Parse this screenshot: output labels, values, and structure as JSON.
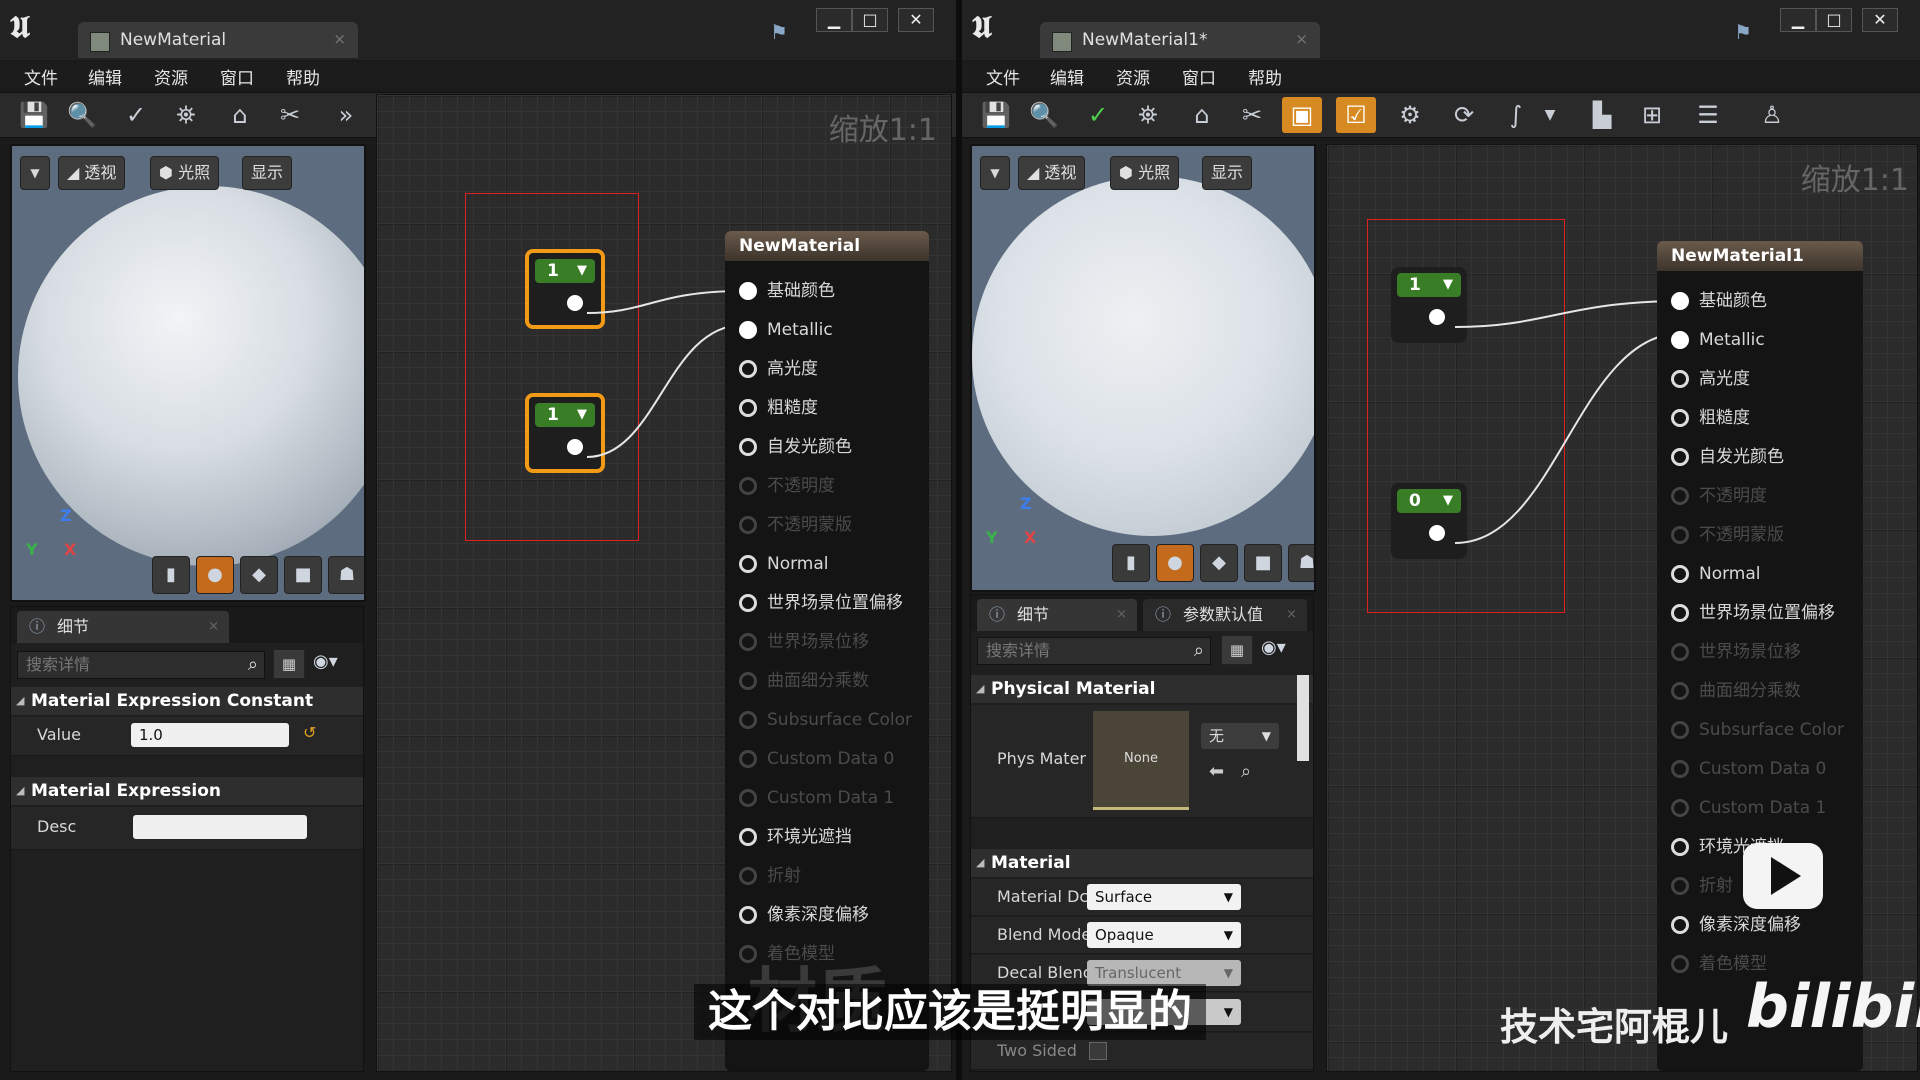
{
  "left": {
    "tab_title": "NewMaterial",
    "tab_close": "×",
    "window_buttons": [
      "▁",
      "□",
      "✕"
    ],
    "menu": [
      "文件",
      "编辑",
      "资源",
      "窗口",
      "帮助"
    ],
    "viewport": {
      "perspective": "透视",
      "lit": "光照",
      "show": "显示",
      "axis_z": "Z",
      "axis_x": "X",
      "axis_y": "Y"
    },
    "zoom_label": "缩放1:1",
    "constants": [
      {
        "value": "1"
      },
      {
        "value": "1"
      }
    ],
    "material_node": {
      "title": "NewMaterial",
      "pins": [
        {
          "label": "基础颜色",
          "state": "connected"
        },
        {
          "label": "Metallic",
          "state": "connected"
        },
        {
          "label": "高光度",
          "state": "active"
        },
        {
          "label": "粗糙度",
          "state": "active"
        },
        {
          "label": "自发光颜色",
          "state": "active"
        },
        {
          "label": "不透明度",
          "state": "disabled"
        },
        {
          "label": "不透明蒙版",
          "state": "disabled"
        },
        {
          "label": "Normal",
          "state": "active"
        },
        {
          "label": "世界场景位置偏移",
          "state": "active"
        },
        {
          "label": "世界场景位移",
          "state": "disabled"
        },
        {
          "label": "曲面细分乘数",
          "state": "disabled"
        },
        {
          "label": "Subsurface Color",
          "state": "disabled"
        },
        {
          "label": "Custom Data 0",
          "state": "disabled"
        },
        {
          "label": "Custom Data 1",
          "state": "disabled"
        },
        {
          "label": "环境光遮挡",
          "state": "active"
        },
        {
          "label": "折射",
          "state": "disabled"
        },
        {
          "label": "像素深度偏移",
          "state": "active"
        },
        {
          "label": "着色模型",
          "state": "disabled"
        }
      ]
    },
    "details": {
      "tab": "细节",
      "tab_close": "×",
      "search_placeholder": "搜索详情",
      "category1": "Material Expression Constant",
      "value_label": "Value",
      "value": "1.0",
      "category2": "Material Expression",
      "desc_label": "Desc",
      "desc_value": ""
    }
  },
  "right": {
    "tab_title": "NewMaterial1*",
    "tab_close": "×",
    "window_buttons": [
      "▁",
      "□",
      "✕"
    ],
    "menu": [
      "文件",
      "编辑",
      "资源",
      "窗口",
      "帮助"
    ],
    "viewport": {
      "perspective": "透视",
      "lit": "光照",
      "show": "显示",
      "axis_z": "Z",
      "axis_x": "X",
      "axis_y": "Y"
    },
    "zoom_label": "缩放1:1",
    "constants": [
      {
        "value": "1"
      },
      {
        "value": "0"
      }
    ],
    "material_node": {
      "title": "NewMaterial1",
      "pins": [
        {
          "label": "基础颜色",
          "state": "connected"
        },
        {
          "label": "Metallic",
          "state": "connected"
        },
        {
          "label": "高光度",
          "state": "active"
        },
        {
          "label": "粗糙度",
          "state": "active"
        },
        {
          "label": "自发光颜色",
          "state": "active"
        },
        {
          "label": "不透明度",
          "state": "disabled"
        },
        {
          "label": "不透明蒙版",
          "state": "disabled"
        },
        {
          "label": "Normal",
          "state": "active"
        },
        {
          "label": "世界场景位置偏移",
          "state": "active"
        },
        {
          "label": "世界场景位移",
          "state": "disabled"
        },
        {
          "label": "曲面细分乘数",
          "state": "disabled"
        },
        {
          "label": "Subsurface Color",
          "state": "disabled"
        },
        {
          "label": "Custom Data 0",
          "state": "disabled"
        },
        {
          "label": "Custom Data 1",
          "state": "disabled"
        },
        {
          "label": "环境光遮挡",
          "state": "active"
        },
        {
          "label": "折射",
          "state": "disabled"
        },
        {
          "label": "像素深度偏移",
          "state": "active"
        },
        {
          "label": "着色模型",
          "state": "disabled"
        }
      ]
    },
    "details": {
      "tab1": "细节",
      "tab2": "参数默认值",
      "tab_close": "×",
      "search_placeholder": "搜索详情",
      "cat_physical": "Physical Material",
      "phys_label": "Phys Mater",
      "phys_thumb": "None",
      "phys_dropdown": "无",
      "cat_material": "Material",
      "domain_label": "Material Dc",
      "domain_value": "Surface",
      "blend_label": "Blend Mode",
      "blend_value": "Opaque",
      "decal_label": "Decal Blenc",
      "decal_value": "Translucent",
      "twosided_label": "Two Sided"
    }
  },
  "overlay": {
    "subtitle": "这个对比应该是挺明显的",
    "watermark": "技术宅阿棍儿",
    "bili_logo": "bilibili",
    "faint_text": "材质"
  },
  "colors": {
    "constant_header": "#3a7d27",
    "selection": "#f29a15",
    "selection_box": "#dd2222",
    "active_toolbar": "#d88a22"
  }
}
